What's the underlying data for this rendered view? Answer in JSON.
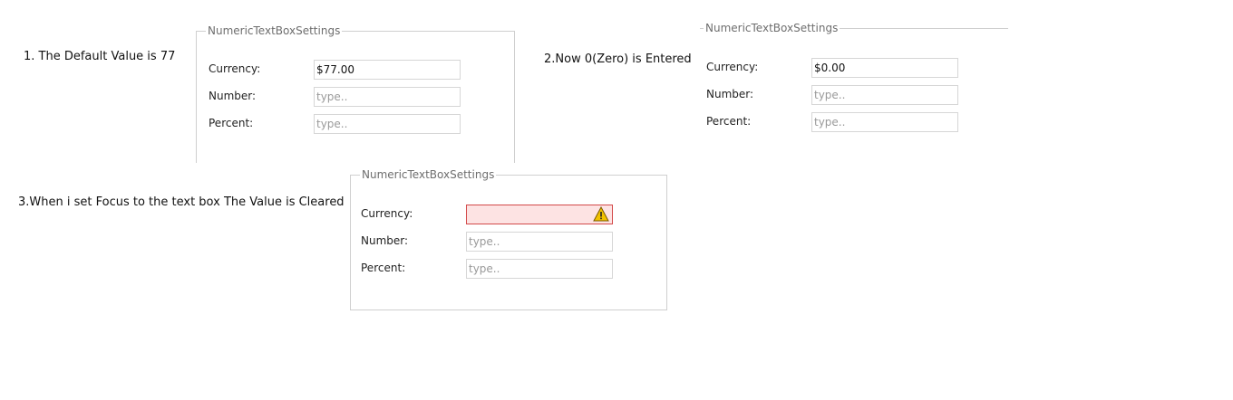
{
  "steps": {
    "one": "1.  The Default Value is 77",
    "two": "2.Now 0(Zero) is Entered",
    "three": "3.When i set Focus to the text box The Value is Cleared"
  },
  "panels": [
    {
      "legend": "NumericTextBoxSettings",
      "currency_label": "Currency:",
      "currency_value": "$77.00",
      "number_label": "Number:",
      "number_placeholder": "type..",
      "percent_label": "Percent:",
      "percent_placeholder": "type.."
    },
    {
      "legend": "NumericTextBoxSettings",
      "currency_label": "Currency:",
      "currency_value": "$0.00",
      "number_label": "Number:",
      "number_placeholder": "type..",
      "percent_label": "Percent:",
      "percent_placeholder": "type.."
    },
    {
      "legend": "NumericTextBoxSettings",
      "currency_label": "Currency:",
      "currency_value": "",
      "number_label": "Number:",
      "number_placeholder": "type..",
      "percent_label": "Percent:",
      "percent_placeholder": "type.."
    }
  ],
  "colors": {
    "error_bg": "#fde3e3",
    "error_border": "#d34a4a",
    "warning": "#f2c200"
  },
  "icons": {
    "warning": "warning-icon"
  }
}
